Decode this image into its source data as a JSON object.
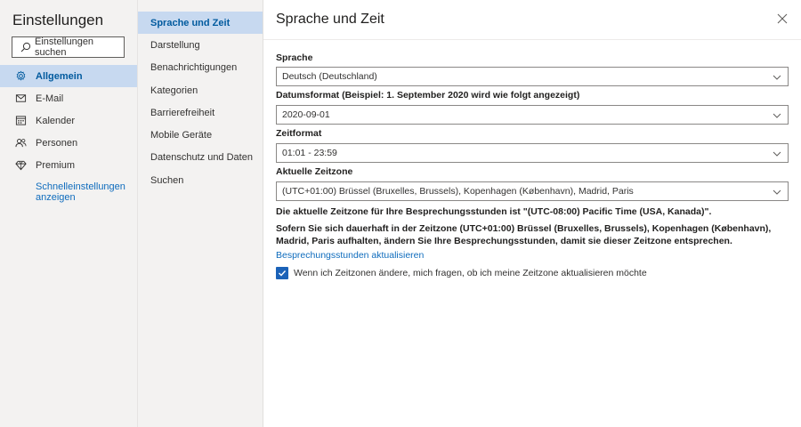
{
  "app": {
    "title": "Einstellungen"
  },
  "search": {
    "placeholder": "Einstellungen suchen"
  },
  "nav_main": [
    {
      "label": "Allgemein",
      "icon": "gear-icon",
      "selected": true
    },
    {
      "label": "E-Mail",
      "icon": "mail-icon",
      "selected": false
    },
    {
      "label": "Kalender",
      "icon": "calendar-icon",
      "selected": false
    },
    {
      "label": "Personen",
      "icon": "people-icon",
      "selected": false
    },
    {
      "label": "Premium",
      "icon": "diamond-icon",
      "selected": false
    }
  ],
  "quick_settings_link": "Schnelleinstellungen anzeigen",
  "nav_sub": [
    {
      "label": "Sprache und Zeit",
      "selected": true
    },
    {
      "label": "Darstellung",
      "selected": false
    },
    {
      "label": "Benachrichtigungen",
      "selected": false
    },
    {
      "label": "Kategorien",
      "selected": false
    },
    {
      "label": "Barrierefreiheit",
      "selected": false
    },
    {
      "label": "Mobile Geräte",
      "selected": false
    },
    {
      "label": "Datenschutz und Daten",
      "selected": false
    },
    {
      "label": "Suchen",
      "selected": false
    }
  ],
  "panel": {
    "title": "Sprache und Zeit",
    "language": {
      "label": "Sprache",
      "value": "Deutsch (Deutschland)"
    },
    "date_format": {
      "label": "Datumsformat (Beispiel: 1. September 2020 wird wie folgt angezeigt)",
      "value": "2020-09-01"
    },
    "time_format": {
      "label": "Zeitformat",
      "value": "01:01 - 23:59"
    },
    "timezone": {
      "label": "Aktuelle Zeitzone",
      "value": "(UTC+01:00) Brüssel (Bruxelles, Brussels), Kopenhagen (København), Madrid, Paris"
    },
    "meeting_hours_info": "Die aktuelle Zeitzone für Ihre Besprechungsstunden ist \"(UTC-08:00) Pacific Time (USA, Kanada)\".",
    "meeting_hours_hint": "Sofern Sie sich dauerhaft in der Zeitzone (UTC+01:00) Brüssel (Bruxelles, Brussels), Kopenhagen (København), Madrid, Paris aufhalten, ändern Sie Ihre Besprechungsstunden, damit sie dieser Zeitzone entsprechen.",
    "update_link": "Besprechungsstunden aktualisieren",
    "ask_checkbox": {
      "label": "Wenn ich Zeitzonen ändere, mich fragen, ob ich meine Zeitzone aktualisieren möchte",
      "checked": true
    }
  },
  "colors": {
    "accent": "#0f6cbd",
    "selected_bg": "#c7d9f0",
    "checkbox": "#1b62b8",
    "sidebar_bg": "#f3f2f1"
  }
}
